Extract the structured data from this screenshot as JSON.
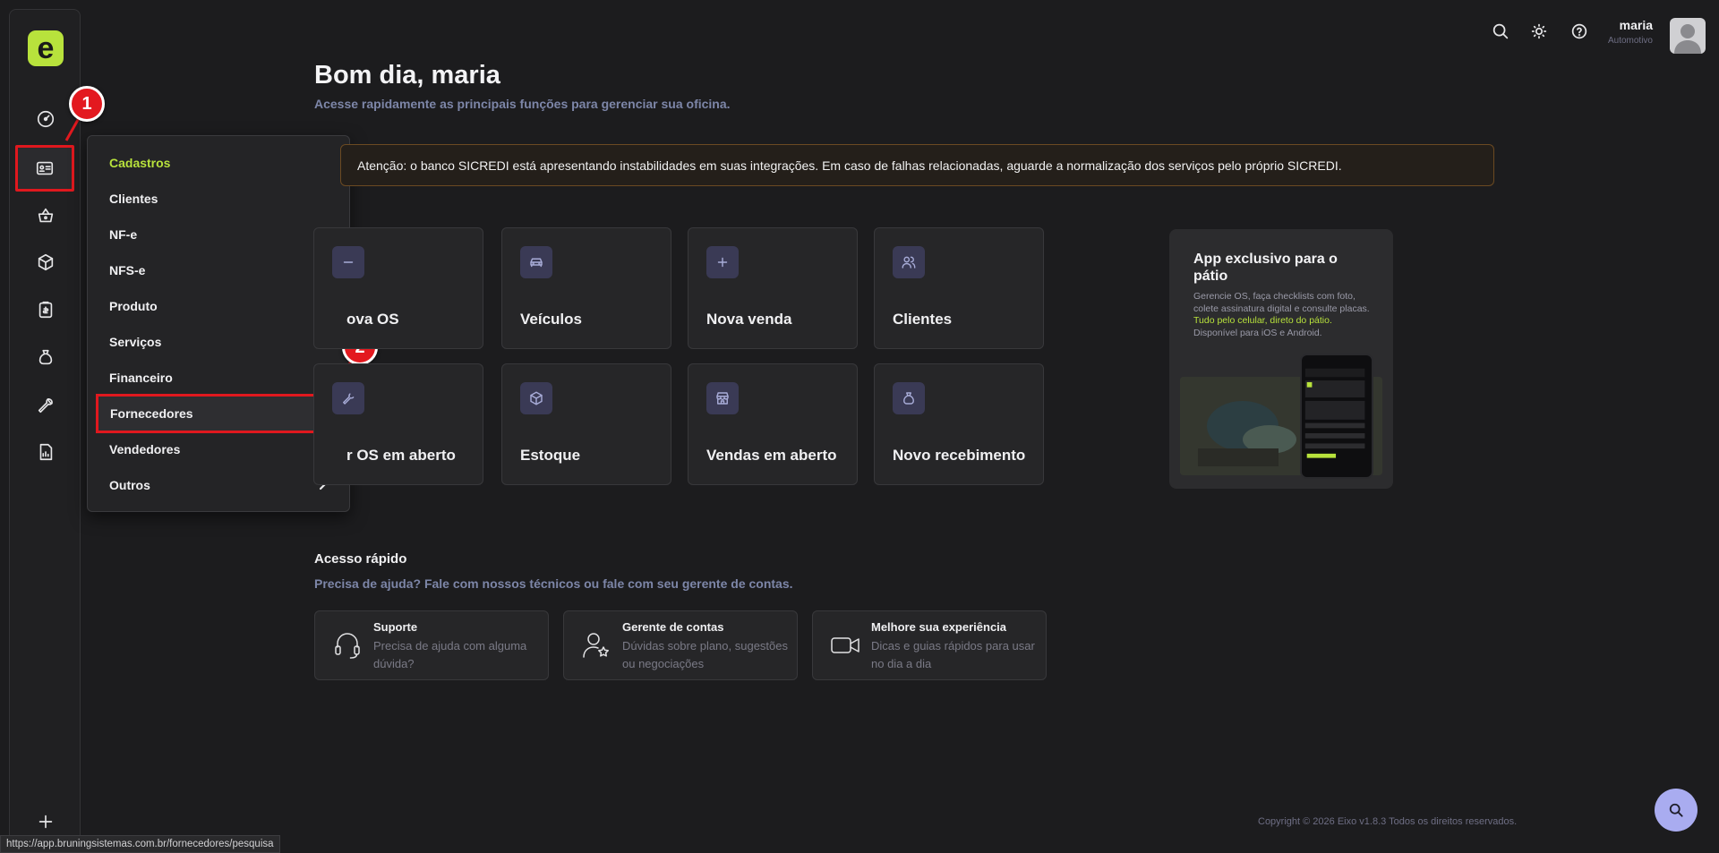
{
  "app": {
    "logo_letter": "e",
    "brand_color": "#b8e23c",
    "alert_color": "#e0181e"
  },
  "sidebar": {
    "items": [
      {
        "icon": "dashboard-icon"
      },
      {
        "icon": "registry-card-icon",
        "active": true
      },
      {
        "icon": "basket-icon"
      },
      {
        "icon": "box-icon"
      },
      {
        "icon": "clipboard-icon"
      },
      {
        "icon": "bag-icon"
      },
      {
        "icon": "wrench-icon"
      },
      {
        "icon": "report-icon"
      }
    ],
    "expand_arrow": "→",
    "add_icon": "plus-icon"
  },
  "annotations": {
    "step1": "1",
    "step2": "2"
  },
  "menu": {
    "title": "Cadastros",
    "items": [
      {
        "label": "Clientes",
        "submenu": false
      },
      {
        "label": "NF-e",
        "submenu": true
      },
      {
        "label": "NFS-e",
        "submenu": true
      },
      {
        "label": "Produto",
        "submenu": true
      },
      {
        "label": "Serviços",
        "submenu": true
      },
      {
        "label": "Financeiro",
        "submenu": true
      },
      {
        "label": "Fornecedores",
        "submenu": false,
        "highlighted": true
      },
      {
        "label": "Vendedores",
        "submenu": false
      },
      {
        "label": "Outros",
        "submenu": true
      }
    ]
  },
  "topbar": {
    "user_name": "maria",
    "user_role": "Automotivo"
  },
  "main": {
    "greeting": "Bom dia, maria",
    "greeting_sub": "Acesse rapidamente as principais funções para gerenciar sua oficina.",
    "alert": "Atenção: o banco SICREDI está apresentando instabilidades em suas integrações. Em caso de falhas relacionadas, aguarde a normalização dos serviços pelo próprio SICREDI.",
    "cards": [
      {
        "label": "ova OS",
        "icon": "minus-icon"
      },
      {
        "label": "Veículos",
        "icon": "car-icon"
      },
      {
        "label": "Nova venda",
        "icon": "plus-icon"
      },
      {
        "label": "Clientes",
        "icon": "users-icon"
      },
      {
        "label": "r OS em aberto",
        "icon": "wrench-icon"
      },
      {
        "label": "Estoque",
        "icon": "box-icon"
      },
      {
        "label": "Vendas em aberto",
        "icon": "store-icon"
      },
      {
        "label": "Novo recebimento",
        "icon": "money-bag-icon"
      }
    ]
  },
  "promo": {
    "title": "App exclusivo para o pátio",
    "text_plain": "Gerencie OS, faça checklists com foto, colete assinatura digital e consulte placas.",
    "text_highlight": "Tudo pelo celular, direto do pátio.",
    "text_end": "Disponível para iOS e Android."
  },
  "quick_access": {
    "title": "Acesso rápido",
    "subtitle": "Precisa de ajuda? Fale com nossos técnicos ou fale com seu gerente de contas.",
    "cards": [
      {
        "title": "Suporte",
        "desc": "Precisa de ajuda com alguma dúvida?",
        "icon": "headset-icon"
      },
      {
        "title": "Gerente de contas",
        "desc": "Dúvidas sobre plano, sugestões ou negociações",
        "icon": "user-star-icon"
      },
      {
        "title": "Melhore sua experiência",
        "desc": "Dicas e guias rápidos para usar no dia a dia",
        "icon": "video-icon"
      }
    ]
  },
  "footer": "Copyright © 2026 Eixo v1.8.3 Todos os direitos reservados.",
  "status_url": "https://app.bruningsistemas.com.br/fornecedores/pesquisa"
}
